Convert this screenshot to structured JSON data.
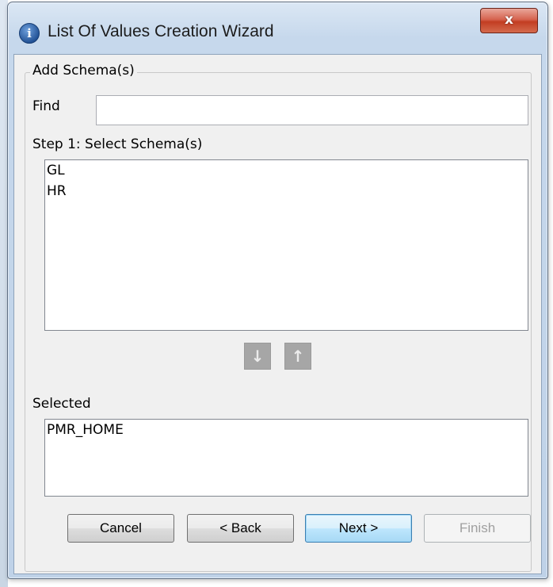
{
  "window": {
    "title": "List Of Values Creation Wizard",
    "icon": "info-icon",
    "icon_glyph": "i",
    "close_glyph": "x"
  },
  "group": {
    "legend": "Add Schema(s)"
  },
  "find": {
    "label": "Find",
    "value": ""
  },
  "step1": {
    "label": "Step 1: Select Schema(s)",
    "items": [
      "GL",
      "HR"
    ]
  },
  "move_buttons": {
    "down_glyph": "↓",
    "up_glyph": "↑",
    "down_icon": "arrow-down-icon",
    "up_icon": "arrow-up-icon",
    "state": "disabled"
  },
  "selected": {
    "label": "Selected",
    "items": [
      "PMR_HOME"
    ]
  },
  "buttons": {
    "cancel": "Cancel",
    "back": "< Back",
    "next": "Next >",
    "finish": "Finish"
  },
  "colors": {
    "close_button": "#c9452b",
    "default_button_border": "#3c7fb1",
    "disabled_text": "#a0a0a0"
  }
}
